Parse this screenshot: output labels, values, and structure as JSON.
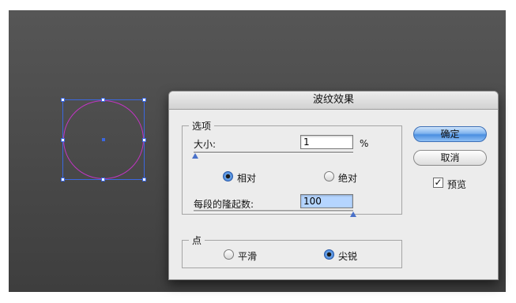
{
  "dialog": {
    "title": "波纹效果",
    "options_group": {
      "legend": "选项",
      "size_label": "大小:",
      "size_value": "1",
      "size_unit": "%",
      "relative_label": "相对",
      "absolute_label": "绝对",
      "relative_selected": true,
      "ridges_label": "每段的隆起数:",
      "ridges_value": "100"
    },
    "points_group": {
      "legend": "点",
      "smooth_label": "平滑",
      "sharp_label": "尖锐",
      "sharp_selected": true
    },
    "buttons": {
      "ok_label": "确定",
      "cancel_label": "取消"
    },
    "preview_label": "预览",
    "preview_checked": true
  },
  "colors": {
    "selection": "#3b67e0",
    "circle_stroke": "#c235c4",
    "default_button": "#4a8ee0"
  }
}
